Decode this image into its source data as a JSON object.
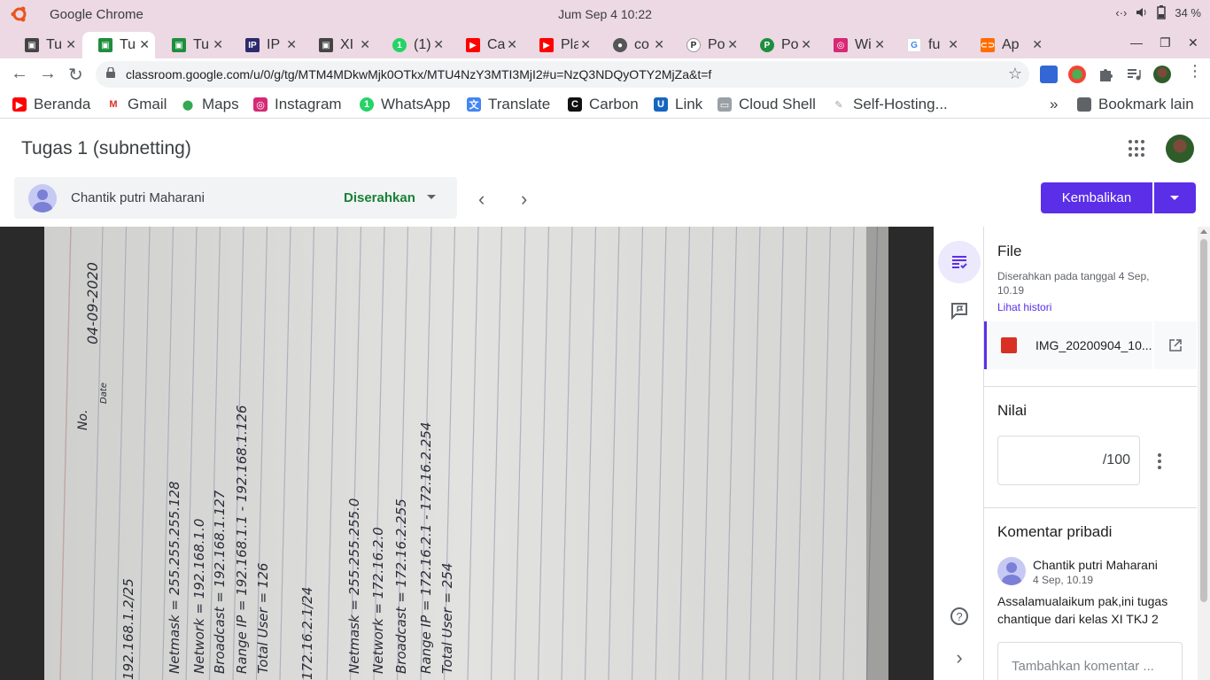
{
  "os": {
    "app_name": "Google Chrome",
    "clock": "Jum Sep 4  10:22",
    "battery": "34 %"
  },
  "tabs": [
    {
      "title": "Tu",
      "icon": "classroom-icon"
    },
    {
      "title": "Tu",
      "icon": "classroom-icon"
    },
    {
      "title": "Tu",
      "icon": "classroom-icon"
    },
    {
      "title": "IP",
      "icon": "ip-icon"
    },
    {
      "title": "XI",
      "icon": "classroom-icon"
    },
    {
      "title": "(1)",
      "icon": "whatsapp-icon"
    },
    {
      "title": "Ca",
      "icon": "youtube-icon"
    },
    {
      "title": "Pla",
      "icon": "youtube-icon"
    },
    {
      "title": "co",
      "icon": "globe-icon"
    },
    {
      "title": "Po",
      "icon": "p-icon"
    },
    {
      "title": "Po",
      "icon": "p-green-icon"
    },
    {
      "title": "Wi",
      "icon": "instagram-icon"
    },
    {
      "title": "fu",
      "icon": "google-icon"
    },
    {
      "title": "Ap",
      "icon": "orange-icon"
    }
  ],
  "url": "classroom.google.com/u/0/g/tg/MTM4MDkwMjk0OTkx/MTU4NzY3MTI3MjI2#u=NzQ3NDQyOTY2MjZa&t=f",
  "bookmarks": {
    "items": [
      "Beranda",
      "Gmail",
      "Maps",
      "Instagram",
      "WhatsApp",
      "Translate",
      "Carbon",
      "Link",
      "Cloud Shell",
      "Self-Hosting..."
    ],
    "overflow": "»",
    "other": "Bookmark lain"
  },
  "page": {
    "title": "Tugas 1 (subnetting)"
  },
  "student": {
    "name": "Chantik putri Maharani",
    "status": "Diserahkan"
  },
  "actions": {
    "return_label": "Kembalikan"
  },
  "notebook": {
    "date": "04-09-2020",
    "no_label": "No.",
    "date_label": "Date",
    "lines": [
      "192.168.1.2/25",
      "Netmask = 255.255.255.128",
      "Network = 192.168.1.0",
      "Broadcast = 192.168.1.127",
      "Range IP = 192.168.1.1 - 192.168.1.126",
      "Total User = 126",
      "172.16.2.1/24",
      "Netmask = 255.255.255.0",
      "Network = 172.16.2.0",
      "Broadcast = 172.16.2.255",
      "Range IP = 172.16.2.1 - 172.16.2.254",
      "Total User = 254"
    ]
  },
  "panel": {
    "file_title": "File",
    "submitted_text": "Diserahkan pada tanggal 4 Sep, 10.19",
    "history_link": "Lihat histori",
    "file_name": "IMG_20200904_10...",
    "grade_title": "Nilai",
    "grade_suffix": "/100",
    "comment_title": "Komentar pribadi",
    "comment_author": "Chantik putri Maharani",
    "comment_time": "4 Sep, 10.19",
    "comment_text": "Assalamualaikum pak,ini tugas chantique dari kelas XI TKJ 2",
    "comment_placeholder": "Tambahkan komentar ..."
  },
  "colors": {
    "accent": "#5b2ee8",
    "status_green": "#188038",
    "os_bar": "#ecd9e3"
  }
}
